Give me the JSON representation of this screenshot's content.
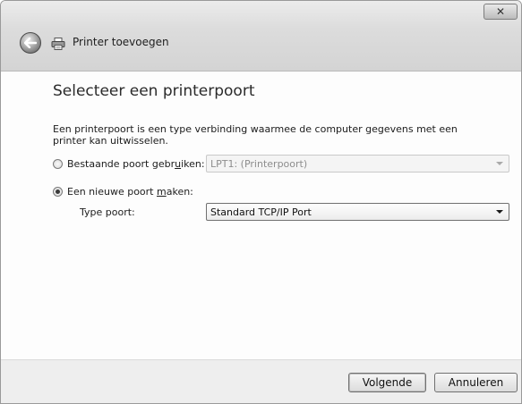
{
  "window": {
    "title": "Printer toevoegen",
    "close_glyph": "✕"
  },
  "page": {
    "heading": "Selecteer een printerpoort",
    "description": "Een printerpoort is een type verbinding waarmee de computer gegevens met een printer kan uitwisselen."
  },
  "options": {
    "existing": {
      "label_before": "Bestaande poort gebr",
      "label_accel": "u",
      "label_after": "iken:",
      "selected": false,
      "dropdown_value": "LPT1: (Printerpoort)"
    },
    "new": {
      "label_before": "Een nieuwe poort ",
      "label_accel": "m",
      "label_after": "aken:",
      "selected": true,
      "type_label": "Type poort:",
      "dropdown_value": "Standard TCP/IP Port"
    }
  },
  "footer": {
    "next_label": "Volgende",
    "cancel_label": "Annuleren"
  },
  "icons": {
    "back": "back-arrow-icon",
    "printer": "printer-icon",
    "close": "close-icon"
  }
}
